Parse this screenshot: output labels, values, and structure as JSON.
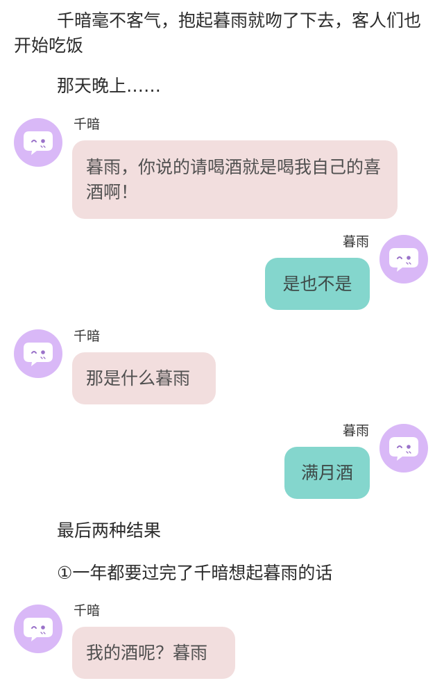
{
  "narration": {
    "intro": "千暗毫不客气，抱起暮雨就吻了下去，客人们也开始吃饭",
    "that_night": "那天晚上……",
    "ending": "最后两种结果",
    "ending_one": "①一年都要过完了千暗想起暮雨的话"
  },
  "messages": [
    {
      "sender": "千暗",
      "side": "left",
      "text": "暮雨，你说的请喝酒就是喝我自己的喜酒啊！"
    },
    {
      "sender": "暮雨",
      "side": "right",
      "text": "是也不是"
    },
    {
      "sender": "千暗",
      "side": "left",
      "text": "那是什么暮雨"
    },
    {
      "sender": "暮雨",
      "side": "right",
      "text": "满月酒"
    },
    {
      "sender": "千暗",
      "side": "left",
      "text": "我的酒呢？暮雨"
    }
  ],
  "icons": {
    "avatar": "chat-bubble-face-icon"
  },
  "colors": {
    "avatar_bg": "#d9b8f7",
    "left_bubble": "#f2dede",
    "right_bubble": "#84d6cd"
  }
}
